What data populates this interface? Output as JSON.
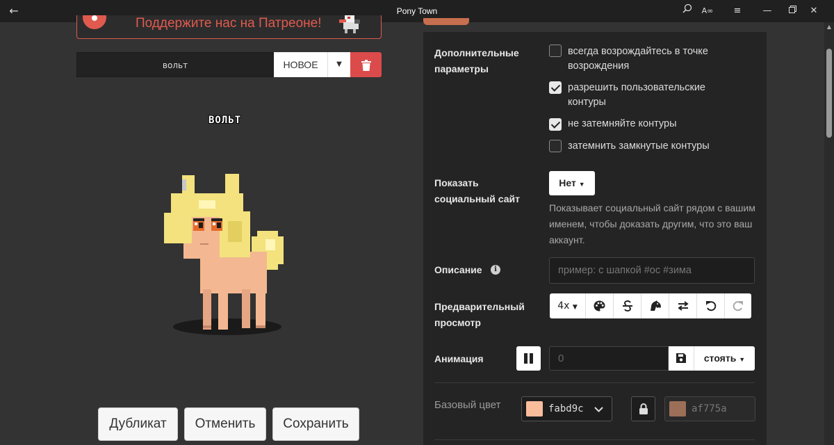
{
  "window": {
    "title": "Pony Town"
  },
  "patreon": {
    "text": "Поддержите нас на Патреоне!"
  },
  "character": {
    "name": "вольт",
    "new_label": "НОВОЕ",
    "preview_name": "ВОЛЬТ"
  },
  "actions": {
    "duplicate": "Дубликат",
    "cancel": "Отменить",
    "save": "Сохранить"
  },
  "settings": {
    "extra_label": "Дополнительные параметры",
    "options": [
      {
        "label": "всегда возрождайтесь в точке возрождения",
        "checked": false
      },
      {
        "label": "разрешить пользовательские контуры",
        "checked": true
      },
      {
        "label": "не затемняйте контуры",
        "checked": true
      },
      {
        "label": "затемнить замкнутые контуры",
        "checked": false
      }
    ],
    "social_label": "Показать социальный сайт",
    "social_value": "Нет",
    "social_help": "Показывает социальный сайт рядом с вашим именем, чтобы доказать другим, что это ваш аккаунт.",
    "description_label": "Описание",
    "description_placeholder": "пример: с шапкой #ос #зима",
    "preview_label": "Предварительный просмотр",
    "preview_zoom": "4x",
    "animation_label": "Анимация",
    "animation_frame": "0",
    "animation_value": "стоять",
    "base_color_label": "Базовый цвет",
    "base_color_hex": "fabd9c",
    "base_color_swatch": "#fabd9c",
    "outline_color_hex": "af775a",
    "outline_color_swatch": "#9c6f58"
  },
  "colors": {
    "accent": "#c86f4f",
    "danger": "#dc4b4b",
    "patreon": "#e05a4f"
  }
}
